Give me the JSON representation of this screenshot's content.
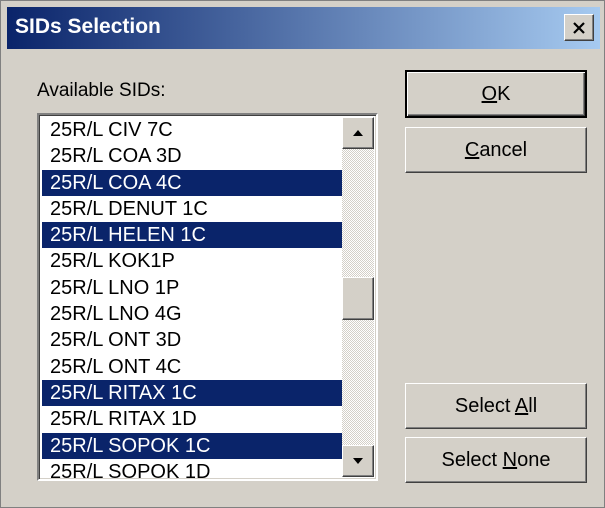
{
  "window": {
    "title": "SIDs Selection",
    "close_label": "close"
  },
  "list": {
    "label": "Available SIDs:",
    "items": [
      {
        "text": "25R/L CIV 7C",
        "selected": false
      },
      {
        "text": "25R/L COA 3D",
        "selected": false
      },
      {
        "text": "25R/L COA 4C",
        "selected": true
      },
      {
        "text": "25R/L DENUT 1C",
        "selected": false
      },
      {
        "text": "25R/L HELEN 1C",
        "selected": true
      },
      {
        "text": "25R/L KOK1P",
        "selected": false
      },
      {
        "text": "25R/L LNO 1P",
        "selected": false
      },
      {
        "text": "25R/L LNO 4G",
        "selected": false
      },
      {
        "text": "25R/L ONT 3D",
        "selected": false
      },
      {
        "text": "25R/L ONT 4C",
        "selected": false
      },
      {
        "text": "25R/L RITAX 1C",
        "selected": true
      },
      {
        "text": "25R/L RITAX 1D",
        "selected": false
      },
      {
        "text": "25R/L SOPOK 1C",
        "selected": true
      },
      {
        "text": "25R/L SOPOK 1D",
        "selected": false
      }
    ]
  },
  "buttons": {
    "ok": {
      "label": "OK",
      "mnemonic": "O",
      "rest": "K"
    },
    "cancel": {
      "label": "Cancel",
      "mnemonic": "C",
      "rest": "ancel"
    },
    "select_all": {
      "label": "Select All",
      "prefix": "Select ",
      "mnemonic": "A",
      "rest": "ll"
    },
    "select_none": {
      "label": "Select None",
      "prefix": "Select ",
      "mnemonic": "N",
      "rest": "one"
    }
  },
  "colors": {
    "selection": "#0a246a",
    "face": "#d4d0c8",
    "title_start": "#0a246a",
    "title_end": "#a6caf0"
  },
  "icons": {
    "close": "close-icon",
    "scroll_up": "arrow-up-icon",
    "scroll_down": "arrow-down-icon"
  }
}
